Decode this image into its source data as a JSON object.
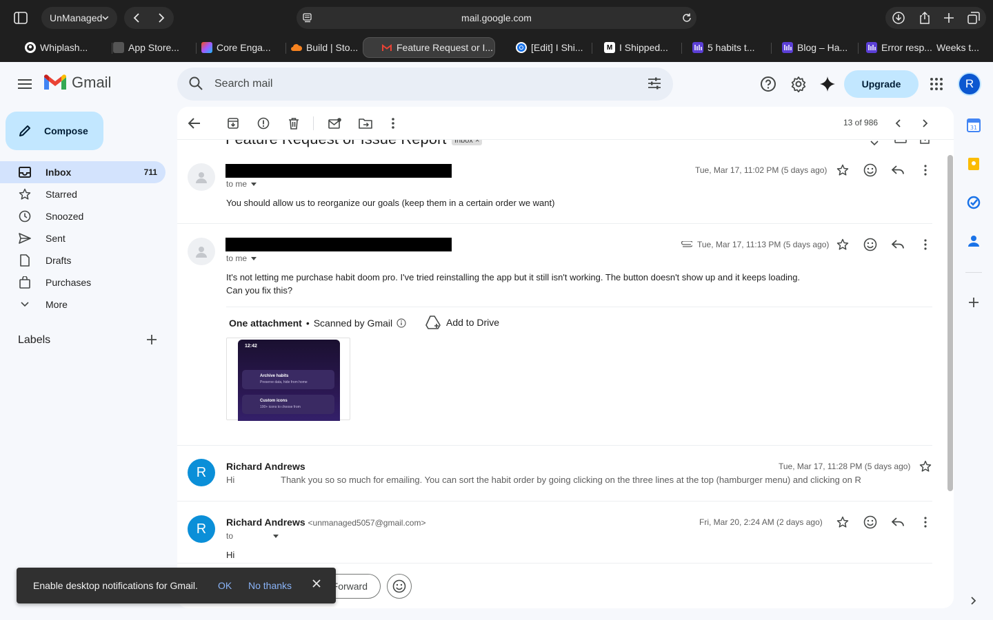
{
  "browser": {
    "profile": "UnManaged",
    "url": "mail.google.com",
    "tabs": [
      {
        "label": "Whiplash...",
        "icon": "github-icon"
      },
      {
        "label": "App Store...",
        "icon": "apple-icon"
      },
      {
        "label": "Core Enga...",
        "icon": "figma-icon"
      },
      {
        "label": "Build | Sto...",
        "icon": "cloud-icon"
      },
      {
        "label": "Feature Request or I...",
        "icon": "gmail-icon",
        "active": true
      },
      {
        "label": "[Edit] I Shi...",
        "icon": "chrome-icon"
      },
      {
        "label": "I Shipped...",
        "icon": "medium-icon"
      },
      {
        "label": "5 habits t...",
        "icon": "habit-icon"
      },
      {
        "label": "Blog – Ha...",
        "icon": "habit-icon"
      },
      {
        "label": "Error resp...",
        "icon": "habit-icon"
      },
      {
        "label": "Weeks t...",
        "icon": "none"
      }
    ]
  },
  "gmail": {
    "logo_text": "Gmail",
    "search_placeholder": "Search mail",
    "upgrade": "Upgrade",
    "avatar_letter": "R"
  },
  "nav": {
    "compose": "Compose",
    "items": [
      {
        "label": "Inbox",
        "count": "711",
        "icon": "inbox-icon",
        "active": true
      },
      {
        "label": "Starred",
        "icon": "star-icon"
      },
      {
        "label": "Snoozed",
        "icon": "clock-icon"
      },
      {
        "label": "Sent",
        "icon": "send-icon"
      },
      {
        "label": "Drafts",
        "icon": "draft-icon"
      },
      {
        "label": "Purchases",
        "icon": "bag-icon"
      },
      {
        "label": "More",
        "icon": "chevron-down-icon"
      }
    ],
    "labels_heading": "Labels"
  },
  "thread": {
    "pager": "13 of 986",
    "subject": "Feature Request or Issue Report",
    "label_chip": "Inbox",
    "messages": [
      {
        "to": "to me",
        "date": "Tue, Mar 17, 11:02 PM (5 days ago)",
        "body": "You should allow us to reorganize our goals (keep them in a certain order we want)"
      },
      {
        "to": "to me",
        "date": "Tue, Mar 17, 11:13 PM (5 days ago)",
        "body_line1": "It's not letting me purchase habit doom pro. I've tried reinstalling the app but it still isn't working. The button doesn't show up and it keeps loading.",
        "body_line2": "Can you fix this?",
        "attachment_heading": "One attachment",
        "scanned": "Scanned by Gmail",
        "add_to_drive": "Add to Drive",
        "thumb": {
          "time": "12:42",
          "card1_title": "Archive habits",
          "card1_sub": "Preserve data, hide from home",
          "card2_title": "Custom icons",
          "card2_sub": "100+ icons to choose from"
        }
      },
      {
        "sender": "Richard Andrews",
        "date": "Tue, Mar 17, 11:28 PM (5 days ago)",
        "snippet_start": "Hi",
        "snippet": "Thank you so so much for emailing. You can sort the habit order by going clicking on the three lines at the top (hamburger menu) and clicking on R"
      },
      {
        "sender": "Richard Andrews",
        "sender_email": "<unmanaged5057@gmail.com>",
        "to": "to",
        "date": "Fri, Mar 20, 2:24 AM (2 days ago)",
        "body": "Hi"
      }
    ],
    "forward_label": "Forward"
  },
  "snackbar": {
    "text": "Enable desktop notifications for Gmail.",
    "ok": "OK",
    "no_thanks": "No thanks"
  },
  "colors": {
    "accent": "#0b57d0",
    "compose_bg": "#c2e7ff",
    "active_nav": "#d3e3fd",
    "page_bg": "#f6f8fc"
  }
}
